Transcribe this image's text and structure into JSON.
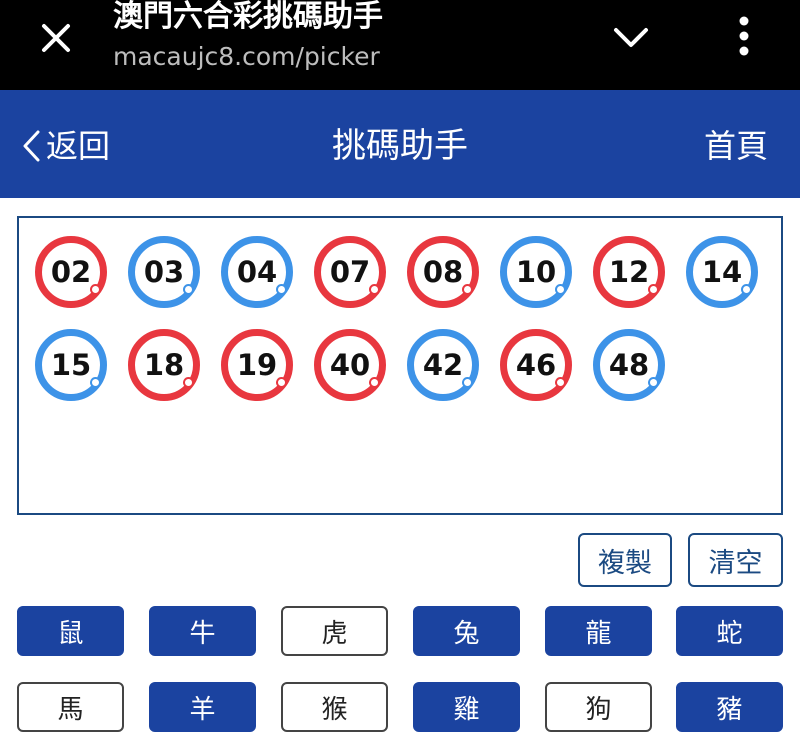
{
  "browser": {
    "title": "澳門六合彩挑碼助手",
    "url": "macaujc8.com/picker"
  },
  "nav": {
    "back_label": "返回",
    "title": "挑碼助手",
    "home_label": "首頁"
  },
  "balls": [
    {
      "num": "02",
      "color": "red"
    },
    {
      "num": "03",
      "color": "blue"
    },
    {
      "num": "04",
      "color": "blue"
    },
    {
      "num": "07",
      "color": "red"
    },
    {
      "num": "08",
      "color": "red"
    },
    {
      "num": "10",
      "color": "blue"
    },
    {
      "num": "12",
      "color": "red"
    },
    {
      "num": "14",
      "color": "blue"
    },
    {
      "num": "15",
      "color": "blue"
    },
    {
      "num": "18",
      "color": "red"
    },
    {
      "num": "19",
      "color": "red"
    },
    {
      "num": "40",
      "color": "red"
    },
    {
      "num": "42",
      "color": "blue"
    },
    {
      "num": "46",
      "color": "red"
    },
    {
      "num": "48",
      "color": "blue"
    }
  ],
  "actions": {
    "copy_label": "複製",
    "clear_label": "清空"
  },
  "zodiac": [
    {
      "label": "鼠",
      "selected": true
    },
    {
      "label": "牛",
      "selected": true
    },
    {
      "label": "虎",
      "selected": false
    },
    {
      "label": "兔",
      "selected": true
    },
    {
      "label": "龍",
      "selected": true
    },
    {
      "label": "蛇",
      "selected": true
    },
    {
      "label": "馬",
      "selected": false
    },
    {
      "label": "羊",
      "selected": true
    },
    {
      "label": "猴",
      "selected": false
    },
    {
      "label": "雞",
      "selected": true
    },
    {
      "label": "狗",
      "selected": false
    },
    {
      "label": "豬",
      "selected": true
    }
  ],
  "colors": {
    "header_blue": "#1b43a0",
    "ball_red": "#e8373f",
    "ball_blue": "#3d93e8",
    "border_navy": "#1b4a82"
  }
}
